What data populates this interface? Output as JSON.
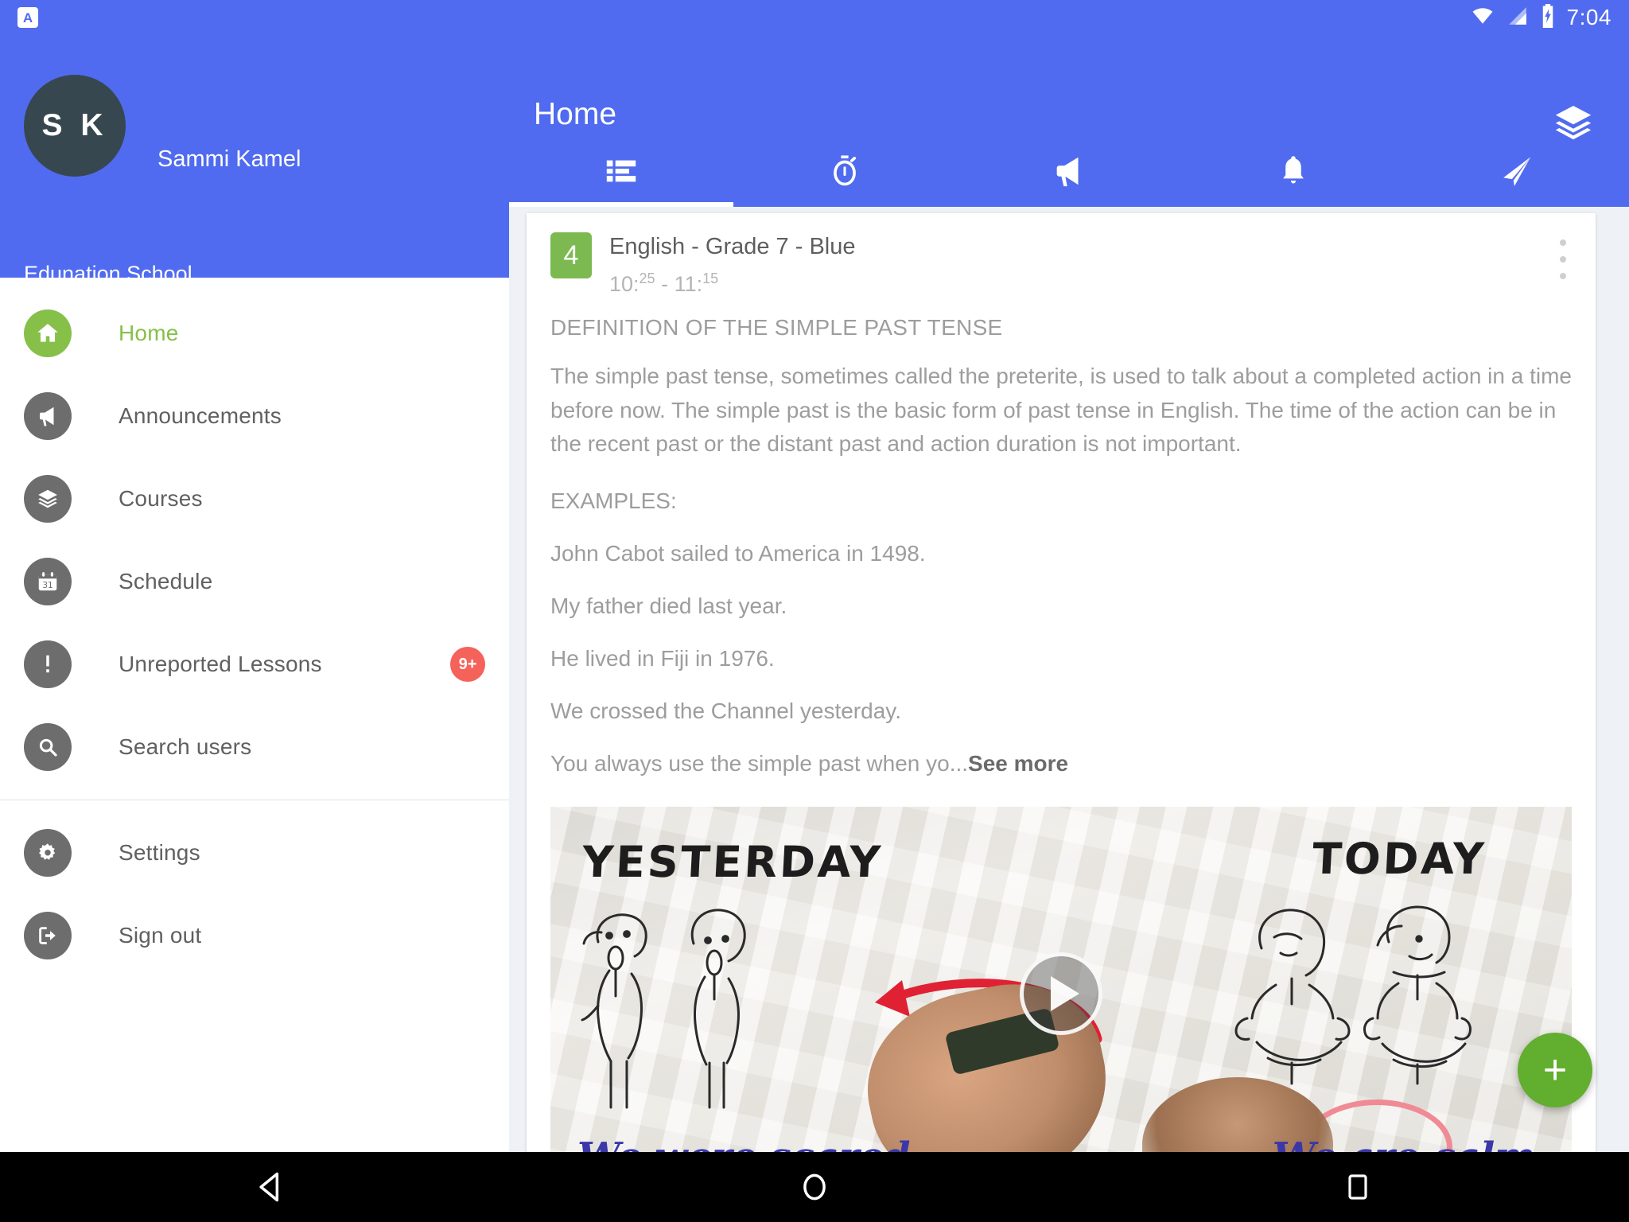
{
  "status_bar": {
    "app_icon": "app-notification-icon",
    "app_icon_letter": "A",
    "wifi_icon": "wifi-icon",
    "signal_icon": "cellular-signal-icon",
    "battery_icon": "battery-charging-icon",
    "time": "7:04"
  },
  "drawer": {
    "avatar_initials": "S K",
    "user_name": "Sammi Kamel",
    "school_name": "Edunation School",
    "items": [
      {
        "label": "Home",
        "icon": "home-icon",
        "active": true,
        "badge": null
      },
      {
        "label": "Announcements",
        "icon": "megaphone-icon",
        "active": false,
        "badge": null
      },
      {
        "label": "Courses",
        "icon": "layers-icon",
        "active": false,
        "badge": null
      },
      {
        "label": "Schedule",
        "icon": "calendar-icon",
        "active": false,
        "badge": null
      },
      {
        "label": "Unreported Lessons",
        "icon": "alert-icon",
        "active": false,
        "badge": "9+"
      },
      {
        "label": "Search users",
        "icon": "search-icon",
        "active": false,
        "badge": null
      },
      {
        "label": "Settings",
        "icon": "gear-icon",
        "active": false,
        "badge": null
      },
      {
        "label": "Sign out",
        "icon": "sign-out-icon",
        "active": false,
        "badge": null
      }
    ]
  },
  "appbar": {
    "title": "Home",
    "action_icon": "layers-icon",
    "tabs": [
      {
        "icon": "list-icon",
        "name": "tab-timeline",
        "selected": true
      },
      {
        "icon": "stopwatch-icon",
        "name": "tab-schedule",
        "selected": false
      },
      {
        "icon": "megaphone-icon",
        "name": "tab-announcements",
        "selected": false
      },
      {
        "icon": "bell-icon",
        "name": "tab-notifications",
        "selected": false
      },
      {
        "icon": "paper-plane-icon",
        "name": "tab-messages",
        "selected": false
      }
    ]
  },
  "card": {
    "lesson_number": "4",
    "course_title": "English - Grade 7 - Blue",
    "time_start_hour": "10:",
    "time_start_min": "25",
    "time_sep": " - ",
    "time_end_hour": "11:",
    "time_end_min": "15",
    "overflow_icon": "more-vertical-icon",
    "heading": "DEFINITION OF THE SIMPLE PAST TENSE",
    "paragraph": "The simple past tense, sometimes called the preterite, is used to talk about a completed action in a time before now. The simple past is the basic form of past tense in English. The time of the action can be in the recent past or the distant past and action duration is not important.",
    "examples_label": "EXAMPLES:",
    "examples": [
      "John Cabot sailed to America in 1498.",
      "My father died last year.",
      "He lived in Fiji in 1976.",
      "We crossed the Channel yesterday."
    ],
    "truncated_line": "You always use the simple past when yo...",
    "see_more": "See more"
  },
  "video": {
    "label_left": "YESTERDAY",
    "label_right": "TODAY",
    "caption_left": "We were scared",
    "caption_right": "We are calm",
    "play_icon": "play-icon"
  },
  "fab": {
    "label": "+",
    "icon": "plus-icon",
    "color": "#62af2f"
  },
  "navbar": {
    "back_icon": "back-triangle-icon",
    "home_icon": "home-circle-icon",
    "recents_icon": "recents-square-icon"
  },
  "colors": {
    "primary_blue": "#506bef",
    "accent_green": "#86c049",
    "badge_green": "#7cba51",
    "badge_red": "#f4625a",
    "text_gray": "#9d9d9d",
    "icon_gray": "#6d6d6d"
  }
}
